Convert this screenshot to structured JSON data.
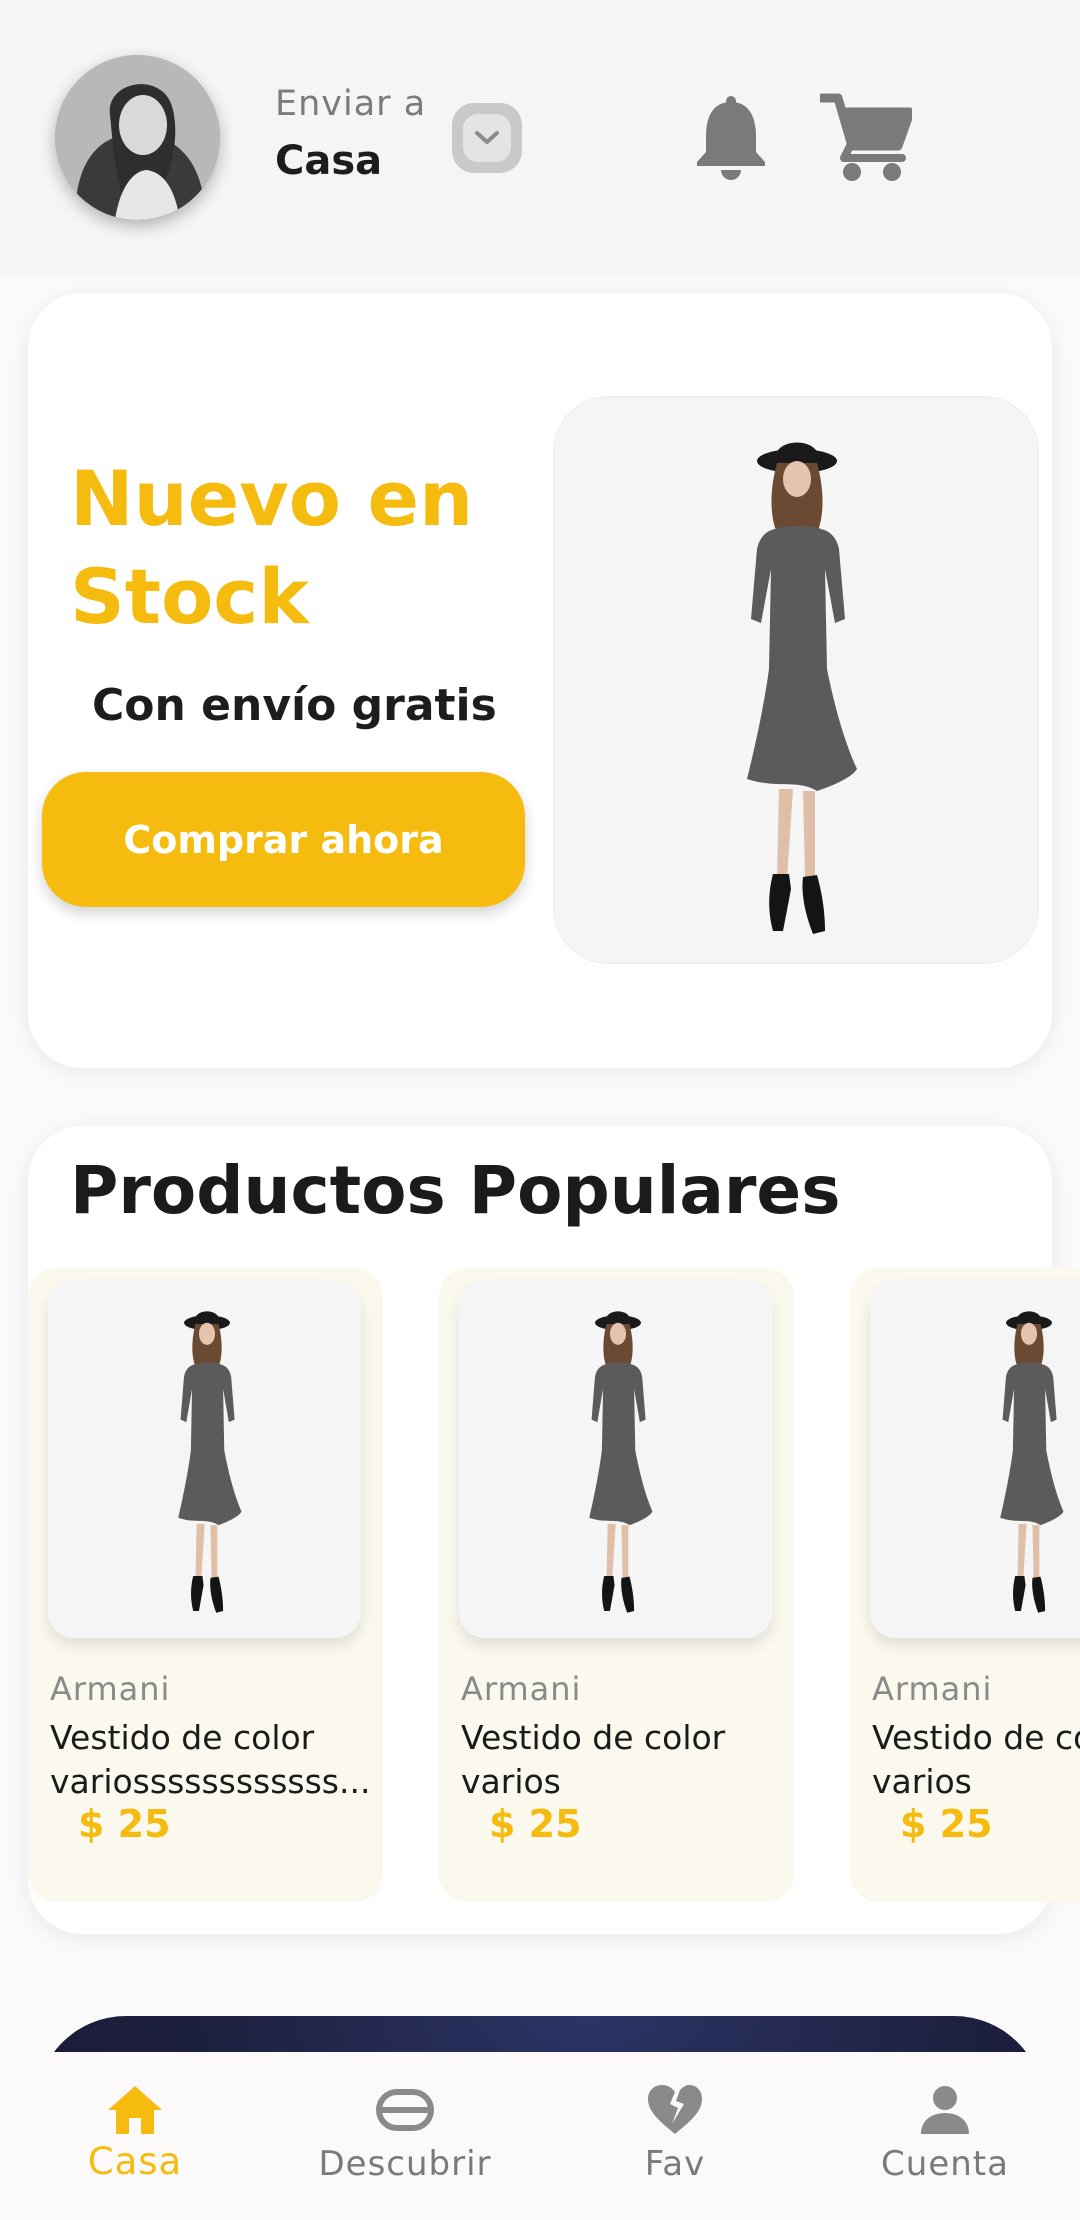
{
  "header": {
    "ship_label": "Enviar a",
    "ship_value": "Casa",
    "icons": [
      "avatar",
      "chevron-down-icon",
      "bell-icon",
      "cart-icon"
    ]
  },
  "promo": {
    "title": "Nuevo en Stock",
    "subtitle": "Con envío gratis",
    "button_label": "Comprar ahora"
  },
  "popular": {
    "title": "Productos Populares",
    "products": [
      {
        "brand": "Armani",
        "name_line1": "Vestido de color",
        "name_line2": "variossssssssssss...",
        "price": "$ 25"
      },
      {
        "brand": "Armani",
        "name_line1": "Vestido de color",
        "name_line2": "varios",
        "price": "$ 25"
      },
      {
        "brand": "Armani",
        "name_line1": "Vestido de color",
        "name_line2": "varios",
        "price": "$ 25"
      }
    ]
  },
  "nav": {
    "items": [
      {
        "label": "Casa",
        "icon": "home-icon",
        "active": true
      },
      {
        "label": "Descubrir",
        "icon": "discover-icon",
        "active": false
      },
      {
        "label": "Fav",
        "icon": "broken-heart-icon",
        "active": false
      },
      {
        "label": "Cuenta",
        "icon": "person-icon",
        "active": false
      }
    ]
  },
  "colors": {
    "accent": "#f5bb0e",
    "background": "#fcf9fb",
    "header_bg": "#f5f5f5",
    "card_bg": "#ffffff",
    "product_card_bg": "#fbf9ee",
    "icon_gray": "#8a8a8a"
  }
}
